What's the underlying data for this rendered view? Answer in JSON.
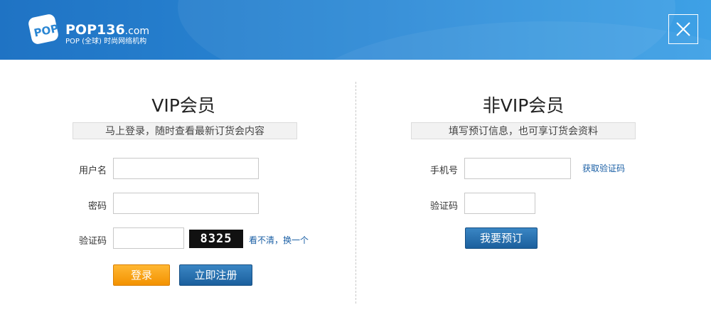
{
  "header": {
    "logo_text": "POP",
    "brand_name": "POP136",
    "brand_suffix": ".com",
    "tagline": "POP (全球) 时尚网络机构",
    "close_icon": "close-icon"
  },
  "vip": {
    "title": "VIP会员",
    "subtitle": "马上登录，随时查看最新订货会内容",
    "username_label": "用户名",
    "username_value": "",
    "password_label": "密码",
    "password_value": "",
    "captcha_label": "验证码",
    "captcha_value": "",
    "captcha_code": "8325",
    "refresh_link": "看不清，换一个",
    "login_button": "登录",
    "register_button": "立即注册"
  },
  "nonvip": {
    "title": "非VIP会员",
    "subtitle": "填写预订信息，也可享订货会资料",
    "phone_label": "手机号",
    "phone_value": "",
    "get_code_link": "获取验证码",
    "code_label": "验证码",
    "code_value": "",
    "reserve_button": "我要预订"
  },
  "colors": {
    "header_blue": "#2a86d3",
    "orange_button": "#f39200",
    "blue_button": "#1b5f9d",
    "link_blue": "#1a5fa5"
  }
}
